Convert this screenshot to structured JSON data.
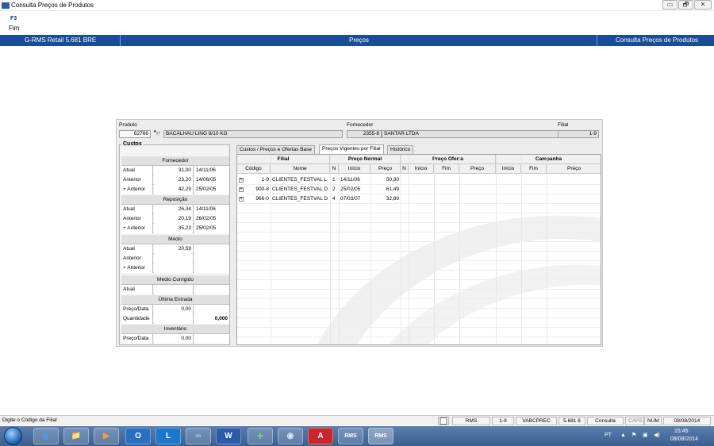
{
  "window": {
    "title": "Consulta Preços de Produtos",
    "min": "▭",
    "max": "🗗",
    "close": "✕"
  },
  "toolbar": {
    "key": "F3",
    "label": "Fim"
  },
  "header": {
    "left": "G-RMS Retail 5.681 BRE",
    "center": "Preços",
    "right": "Consulta Preços de Produtos"
  },
  "produto": {
    "label": "Produto",
    "code": "62766",
    "name": "BACALHAU LING 8/10 KG"
  },
  "fornecedor": {
    "label": "Fornecedor",
    "code": "2355-8",
    "name": "SANTAR LTDA"
  },
  "filial": {
    "label": "Filial",
    "value": "1-9"
  },
  "custos": {
    "title": "Custos",
    "sections": [
      {
        "header": "Fornecedor",
        "rows": [
          {
            "label": "Atual",
            "value": "31,00",
            "date": "14/11/06"
          },
          {
            "label": "Anterior",
            "value": "23,20",
            "date": "14/06/05"
          },
          {
            "label": "+ Anterior",
            "value": "42,29",
            "date": "25/02/05"
          }
        ]
      },
      {
        "header": "Reposição",
        "rows": [
          {
            "label": "Atual",
            "value": "26,34",
            "date": "14/11/06"
          },
          {
            "label": "Anterior",
            "value": "20,19",
            "date": "26/02/05"
          },
          {
            "label": "+ Anterior",
            "value": "35,23",
            "date": "25/02/05"
          }
        ]
      },
      {
        "header": "Médio",
        "rows": [
          {
            "label": "Atual",
            "value": "20,59",
            "date": ""
          },
          {
            "label": "Anterior",
            "value": "",
            "date": ""
          },
          {
            "label": "+ Anterior",
            "value": "",
            "date": ""
          }
        ]
      },
      {
        "header": "Médio Corrigido",
        "rows": [
          {
            "label": "Atual",
            "value": "",
            "date": ""
          }
        ]
      },
      {
        "header": "Última Entrada",
        "rows": [
          {
            "label": "Preço/Data",
            "value": "0,00",
            "date": ""
          },
          {
            "label": "Quantidade",
            "value": "",
            "date": "0,000"
          }
        ]
      },
      {
        "header": "Inventário",
        "rows": [
          {
            "label": "Preço/Data",
            "value": "0,00",
            "date": ""
          }
        ]
      }
    ]
  },
  "tabs": [
    {
      "label": "Custos / Preços e Ofertas Base"
    },
    {
      "label": "Preços Vigentes por Filial"
    },
    {
      "label": "Histórico"
    }
  ],
  "grid": {
    "groups": [
      "Filial",
      "Preço Normal",
      "Preço Oferta",
      "Campanha"
    ],
    "columns": [
      "Código",
      "Nome",
      "N",
      "Início",
      "Preço",
      "N",
      "Início",
      "Fim",
      "Preço",
      "Início",
      "Fim",
      "Preço"
    ],
    "rows": [
      {
        "codigo": "1-9",
        "nome": "CLIENTES_FESTVAL L",
        "n": "1",
        "inicio": "14/11/06",
        "preco": "50,30"
      },
      {
        "codigo": "900-8",
        "nome": "CLIENTES_FESTVAL D",
        "n": "2",
        "inicio": "25/02/05",
        "preco": "61,49"
      },
      {
        "codigo": "966-0",
        "nome": "CLIENTES_FESTVAL D",
        "n": "4",
        "inicio": "07/03/07",
        "preco": "32,89"
      }
    ]
  },
  "statusbar": {
    "message": "Digite o Código da Filial",
    "items": [
      "RMS",
      "1-9",
      "VABCPREC",
      "5.681.6",
      "Consulta",
      "CAPS",
      "NUM",
      "08/08/2014"
    ]
  },
  "taskbar": {
    "apps": [
      "e",
      "📁",
      "▶",
      "O",
      "L",
      "∞",
      "W",
      "+",
      "◉",
      "A",
      "RMS",
      "RMS"
    ],
    "lang": "PT",
    "time": "15:45",
    "date": "08/08/2014"
  }
}
